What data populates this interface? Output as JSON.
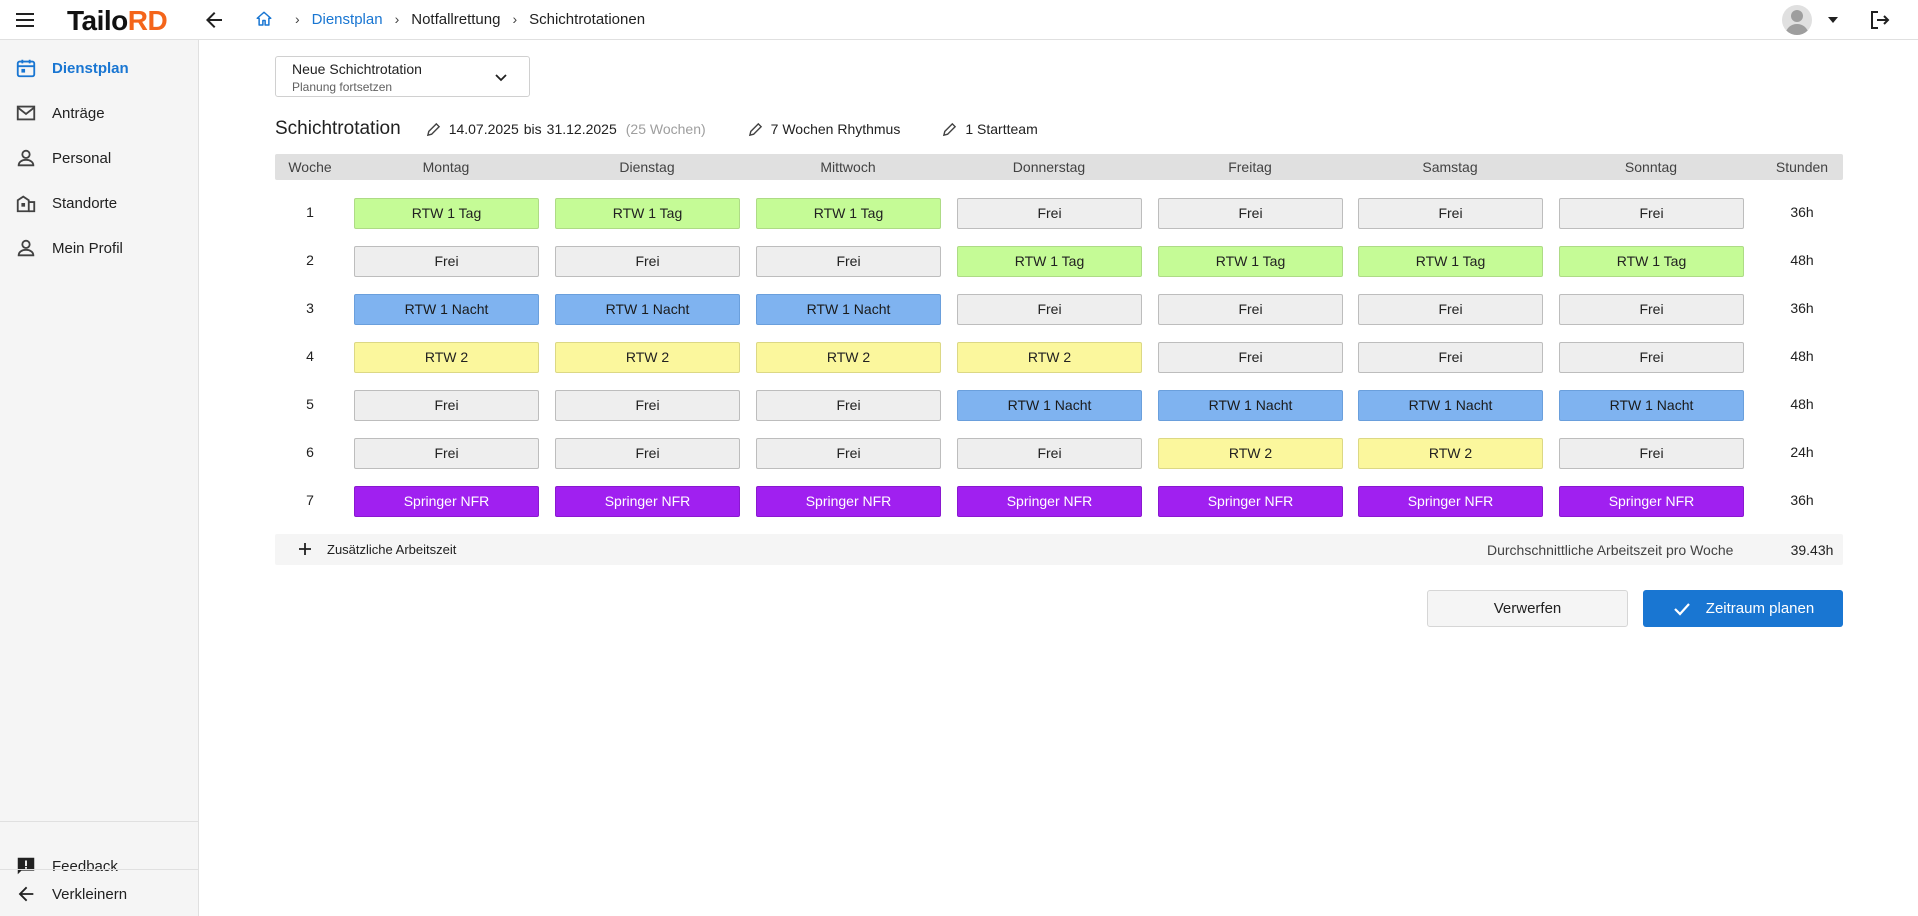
{
  "app": {
    "logo_part1": "Tailo",
    "logo_part2": "RD"
  },
  "breadcrumb": [
    "Dienstplan",
    "Notfallrettung",
    "Schichtrotationen"
  ],
  "sidebar": {
    "items": [
      {
        "label": "Dienstplan",
        "icon": "calendar-icon",
        "active": true
      },
      {
        "label": "Anträge",
        "icon": "mail-icon",
        "active": false
      },
      {
        "label": "Personal",
        "icon": "person-icon",
        "active": false
      },
      {
        "label": "Standorte",
        "icon": "building-icon",
        "active": false
      },
      {
        "label": "Mein Profil",
        "icon": "person-icon",
        "active": false
      }
    ],
    "feedback_label": "Feedback",
    "collapse_label": "Verkleinern"
  },
  "dropdown": {
    "title": "Neue Schichtrotation",
    "subtitle": "Planung fortsetzen"
  },
  "rotation": {
    "title": "Schichtrotation",
    "date_from": "14.07.2025",
    "date_mid": "bis",
    "date_to": "31.12.2025",
    "weeks_hint": "(25 Wochen)",
    "rhythm": "7 Wochen Rhythmus",
    "teams": "1 Startteam"
  },
  "table": {
    "headers": [
      "Woche",
      "Montag",
      "Dienstag",
      "Mittwoch",
      "Donnerstag",
      "Freitag",
      "Samstag",
      "Sonntag",
      "Stunden"
    ],
    "rows": [
      {
        "week": "1",
        "cells": [
          "RTW 1 Tag",
          "RTW 1 Tag",
          "RTW 1 Tag",
          "Frei",
          "Frei",
          "Frei",
          "Frei"
        ],
        "hours": "36h"
      },
      {
        "week": "2",
        "cells": [
          "Frei",
          "Frei",
          "Frei",
          "RTW 1 Tag",
          "RTW 1 Tag",
          "RTW 1 Tag",
          "RTW 1 Tag"
        ],
        "hours": "48h"
      },
      {
        "week": "3",
        "cells": [
          "RTW 1 Nacht",
          "RTW 1 Nacht",
          "RTW 1 Nacht",
          "Frei",
          "Frei",
          "Frei",
          "Frei"
        ],
        "hours": "36h"
      },
      {
        "week": "4",
        "cells": [
          "RTW 2",
          "RTW 2",
          "RTW 2",
          "RTW 2",
          "Frei",
          "Frei",
          "Frei"
        ],
        "hours": "48h"
      },
      {
        "week": "5",
        "cells": [
          "Frei",
          "Frei",
          "Frei",
          "RTW 1 Nacht",
          "RTW 1 Nacht",
          "RTW 1 Nacht",
          "RTW 1 Nacht"
        ],
        "hours": "48h"
      },
      {
        "week": "6",
        "cells": [
          "Frei",
          "Frei",
          "Frei",
          "Frei",
          "RTW 2",
          "RTW 2",
          "Frei"
        ],
        "hours": "24h"
      },
      {
        "week": "7",
        "cells": [
          "Springer NFR",
          "Springer NFR",
          "Springer NFR",
          "Springer NFR",
          "Springer NFR",
          "Springer NFR",
          "Springer NFR"
        ],
        "hours": "36h"
      }
    ],
    "shift_colors": {
      "Frei": "#eeeeee",
      "RTW 1 Tag": "#c5fb96",
      "RTW 1 Nacht": "#7fb3f0",
      "RTW 2": "#fbf79d",
      "Springer NFR": "#a020f0"
    }
  },
  "footer": {
    "add_label": "Zusätzliche Arbeitszeit",
    "avg_label": "Durchschnittliche Arbeitszeit pro Woche",
    "avg_value": "39.43h"
  },
  "actions": {
    "discard_label": "Verwerfen",
    "plan_label": "Zeitraum planen"
  },
  "colors": {
    "accent": "#1976d2",
    "logo_accent": "#f4651a"
  }
}
